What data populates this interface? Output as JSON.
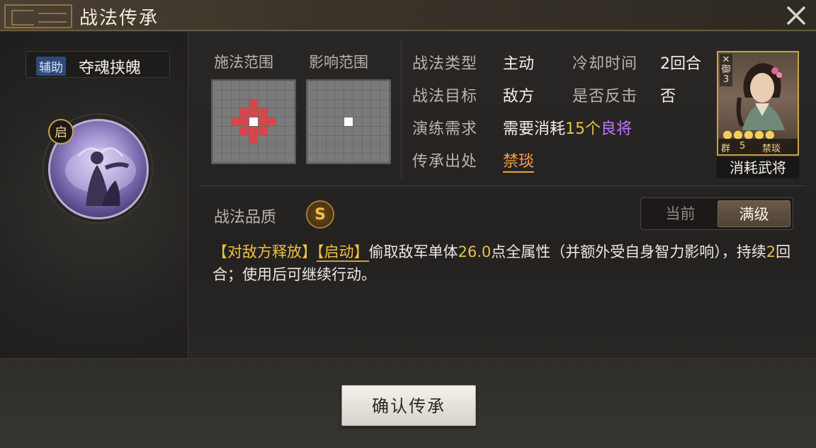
{
  "window": {
    "title": "战法传承"
  },
  "skill": {
    "type_badge": "辅助",
    "name": "夺魂挟魄",
    "trigger_badge": "启",
    "icon": "skill-portrait-icon"
  },
  "ranges": {
    "cast_label": "施法范围",
    "effect_label": "影响范围",
    "cast_grid": [
      "000000000",
      "000000000",
      "000010000",
      "000111000",
      "001121100",
      "000111000",
      "000010000",
      "000000000",
      "000000000"
    ],
    "effect_grid": [
      "000000000",
      "000000000",
      "000000000",
      "000000000",
      "000020000",
      "000000000",
      "000000000",
      "000000000",
      "000000000"
    ]
  },
  "info": {
    "type_label": "战法类型",
    "type_value": "主动",
    "cooldown_label": "冷却时间",
    "cooldown_value": "2回合",
    "target_label": "战法目标",
    "target_value": "敌方",
    "counter_label": "是否反击",
    "counter_value": "否",
    "req_label": "演练需求",
    "req_prefix": "需要消耗",
    "req_count": "15个",
    "req_item": "良将",
    "origin_label": "传承出处",
    "origin_value": "禁琰"
  },
  "general": {
    "side_text": "御",
    "cost": "3",
    "stars": "●●●●●",
    "faction": "群",
    "level": "5",
    "name": "禁琰",
    "consume_label": "消耗武将"
  },
  "quality": {
    "label": "战法品质",
    "grade": "S"
  },
  "toggle": {
    "current": "当前",
    "max": "满级",
    "selected": "max"
  },
  "description": {
    "tag1": "【对敌方释放】",
    "tag2": "【启动】",
    "text1": "偷取敌军单体",
    "num1": "26.0",
    "text2": "点全属性（并额外受自身智力影响），持续",
    "num2": "2",
    "text3": "回合；使用后可继续行动。"
  },
  "actions": {
    "confirm": "确认传承"
  },
  "colors": {
    "accent_gold": "#e6c04a",
    "purple": "#c277ff",
    "orange": "#f0a040",
    "grid_red": "#d7474a"
  }
}
